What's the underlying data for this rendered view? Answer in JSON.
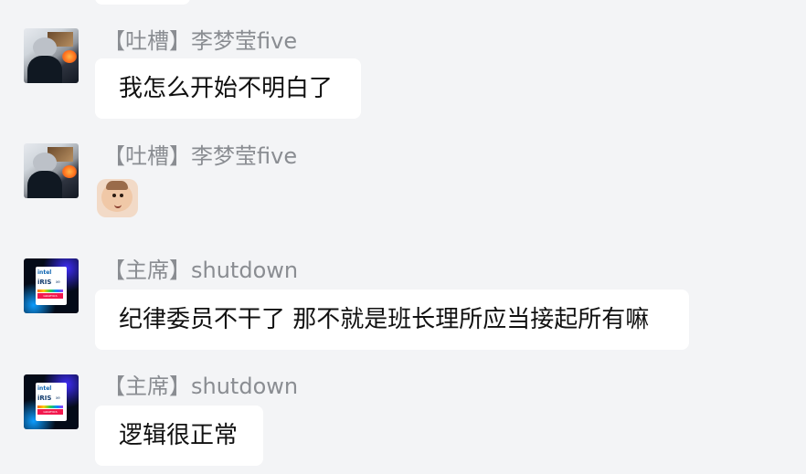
{
  "messages": [
    {
      "sender": "【吐槽】李梦莹five",
      "avatar_icon": "person-photo-icon",
      "text": "我怎么开始不明白了"
    },
    {
      "sender": "【吐槽】李梦莹five",
      "avatar_icon": "person-photo-icon",
      "sticker_icon": "baby-face-sticker-icon"
    },
    {
      "sender": "【主席】shutdown",
      "avatar_icon": "intel-iris-logo-icon",
      "avatar_logo_intel": "intel",
      "avatar_logo_iris": "iRIS",
      "avatar_logo_xe": "xe",
      "avatar_logo_graphics": "GRAPHICS",
      "text": "纪律委员不干了 那不就是班长理所应当接起所有嘛"
    },
    {
      "sender": "【主席】shutdown",
      "avatar_icon": "intel-iris-logo-icon",
      "avatar_logo_intel": "intel",
      "avatar_logo_iris": "iRIS",
      "avatar_logo_xe": "xe",
      "avatar_logo_graphics": "GRAPHICS",
      "text": "逻辑很正常"
    }
  ]
}
